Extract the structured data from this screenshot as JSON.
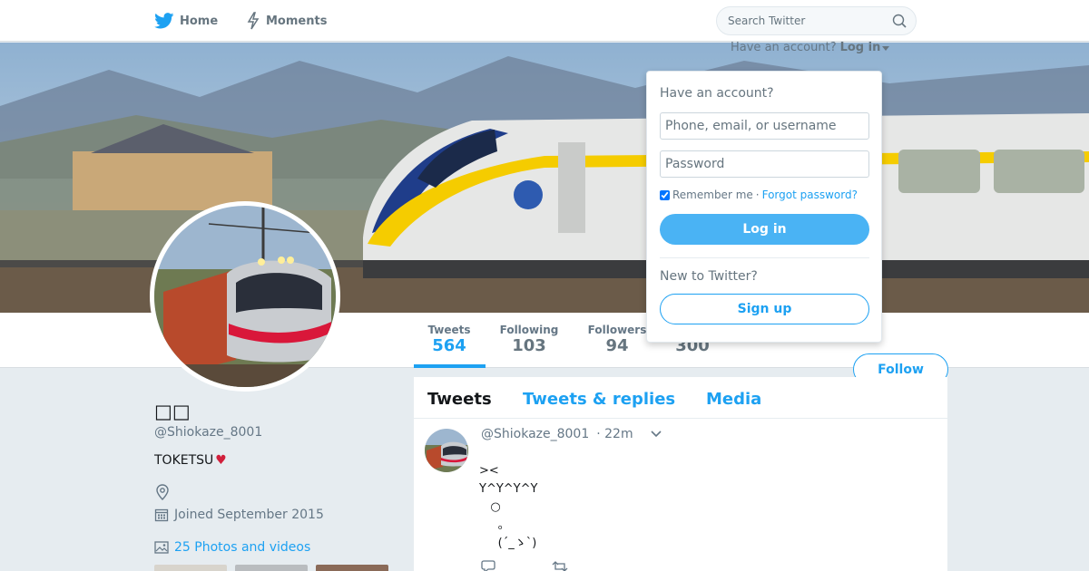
{
  "nav": {
    "home_label": "Home",
    "moments_label": "Moments",
    "search_placeholder": "Search Twitter"
  },
  "login_menu": {
    "prompt": "Have an account?",
    "link_label": "Log in",
    "dropdown_title": "Have an account?",
    "username_placeholder": "Phone, email, or username",
    "password_placeholder": "Password",
    "remember_label": "Remember me",
    "separator": "·",
    "forgot_label": "Forgot password?",
    "login_button": "Log in",
    "new_prompt": "New to Twitter?",
    "signup_button": "Sign up"
  },
  "stats": [
    {
      "label": "Tweets",
      "value": "564"
    },
    {
      "label": "Following",
      "value": "103"
    },
    {
      "label": "Followers",
      "value": "94"
    },
    {
      "label": "",
      "value": "300"
    }
  ],
  "follow_button": "Follow",
  "profile": {
    "name": "□□",
    "handle": "@Shiokaze_8001",
    "bio": "TOKETSU",
    "bio_emoji": "♥",
    "joined": "Joined September 2015",
    "photos_label": "25 Photos and videos"
  },
  "timeline": {
    "tabs": [
      "Tweets",
      "Tweets & replies",
      "Media"
    ],
    "tweet": {
      "handle": "@Shiokaze_8001",
      "time": "· 22m",
      "body": "><\nY^Y^Y^Y\n   ○\n     。\n     (´_ゝ`)"
    }
  },
  "colors": {
    "brand": "#1da1f2",
    "login_button": "#4ab3f4",
    "background": "#e6ecf0"
  }
}
